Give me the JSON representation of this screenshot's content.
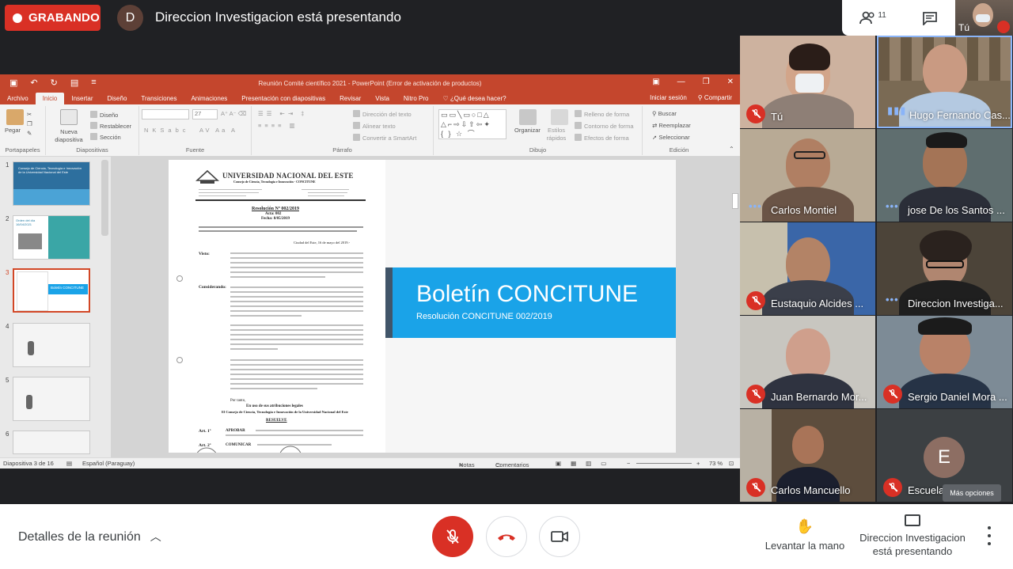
{
  "recording": {
    "label": "GRABANDO"
  },
  "presenter": {
    "avatar_letter": "D",
    "text": "Direccion Investigacion está presentando"
  },
  "top_right": {
    "participants_count": "11",
    "self_label": "Tú"
  },
  "powerpoint": {
    "window_title": "Reunión Comité científico 2021 - PowerPoint (Error de activación de productos)",
    "tabs": [
      "Archivo",
      "Inicio",
      "Insertar",
      "Diseño",
      "Transiciones",
      "Animaciones",
      "Presentación con diapositivas",
      "Revisar",
      "Vista",
      "Nitro Pro",
      "¿Qué desea hacer?"
    ],
    "active_tab": "Inicio",
    "tabs_right": {
      "signin": "Iniciar sesión",
      "share": "Compartir"
    },
    "ribbon": {
      "portapapeles": {
        "label": "Portapapeles",
        "paste": "Pegar"
      },
      "diapositivas": {
        "label": "Diapositivas",
        "new_slide": "Nueva diapositiva",
        "layout": "Diseño",
        "reset": "Restablecer",
        "section": "Sección"
      },
      "fuente": {
        "label": "Fuente",
        "size": "27"
      },
      "parrafo": {
        "label": "Párrafo",
        "text_direction": "Dirección del texto",
        "align_text": "Alinear texto",
        "smartart": "Convertir a SmartArt"
      },
      "dibujo": {
        "label": "Dibujo",
        "arrange": "Organizar",
        "quick_styles": "Estilos rápidos",
        "fill": "Relleno de forma",
        "outline": "Contorno de forma",
        "effects": "Efectos de forma"
      },
      "edicion": {
        "label": "Edición",
        "find": "Buscar",
        "replace": "Reemplazar",
        "select": "Seleccionar"
      }
    },
    "thumb_numbers": [
      "1",
      "2",
      "3",
      "4",
      "5",
      "6"
    ],
    "thumb_texts": {
      "t1": "Consejo de Ciencia, Tecnología e Innovación de la Universidad Nacional del Este",
      "t2": "Orden del día 16/04/2021",
      "t3": "Boletín CONCITUNE"
    },
    "slide": {
      "doc": {
        "university": "UNIVERSIDAD NACIONAL DEL ESTE",
        "council": "Consejo de Ciencia, Tecnología e Innovación - CONCITUNE",
        "resolution": "Resolución Nº 002/2019",
        "acta": "Acta: 002",
        "fecha": "Fecha: 8/05/2019",
        "date_line": "Ciudad del Este, 16 de mayo del 2019.-",
        "visto": "Visto:",
        "considerando": "Considerando:",
        "por_tanto": "Por tanto,",
        "en_uso": "En uso de sus atribuciones legales",
        "consejo": "El Consejo de Ciencia, Tecnología e Innovación de la Universidad Nacional del Este",
        "resuelve": "RESUELVE",
        "art1": "Art. 1º",
        "aprobar": "APROBAR",
        "art2": "Art. 2º",
        "comunicar": "COMUNICAR"
      },
      "banner_title": "Boletín CONCITUNE",
      "banner_subtitle": "Resolución CONCITUNE 002/2019"
    },
    "status": {
      "slide_info": "Diapositiva 3 de 16",
      "language": "Español (Paraguay)",
      "notes": "Notas",
      "comments": "Comentarios",
      "zoom": "73 %"
    }
  },
  "participants": [
    {
      "name": "Tú",
      "muted": true
    },
    {
      "name": "Hugo Fernando Cas...",
      "muted": false,
      "speaking": true
    },
    {
      "name": "Carlos Montiel",
      "muted": false
    },
    {
      "name": "jose De los Santos ...",
      "muted": false
    },
    {
      "name": "Eustaquio Alcides ...",
      "muted": true
    },
    {
      "name": "Direccion Investiga...",
      "muted": false
    },
    {
      "name": "Juan Bernardo Mor...",
      "muted": true
    },
    {
      "name": "Sergio Daniel Mora ...",
      "muted": true
    },
    {
      "name": "Carlos Mancuello",
      "muted": true
    },
    {
      "name": "Escuela ...",
      "muted": true,
      "avatar_letter": "E"
    }
  ],
  "more_options_label": "Más opciones",
  "bottom_bar": {
    "details": "Detalles de la reunión",
    "raise_hand": "Levantar la mano",
    "presenting": "Direccion Investigacion está presentando"
  },
  "colors": {
    "record_red": "#d93025",
    "ppt_orange": "#c4462d",
    "banner_blue": "#1aa3e8",
    "meet_bg": "#202124"
  }
}
